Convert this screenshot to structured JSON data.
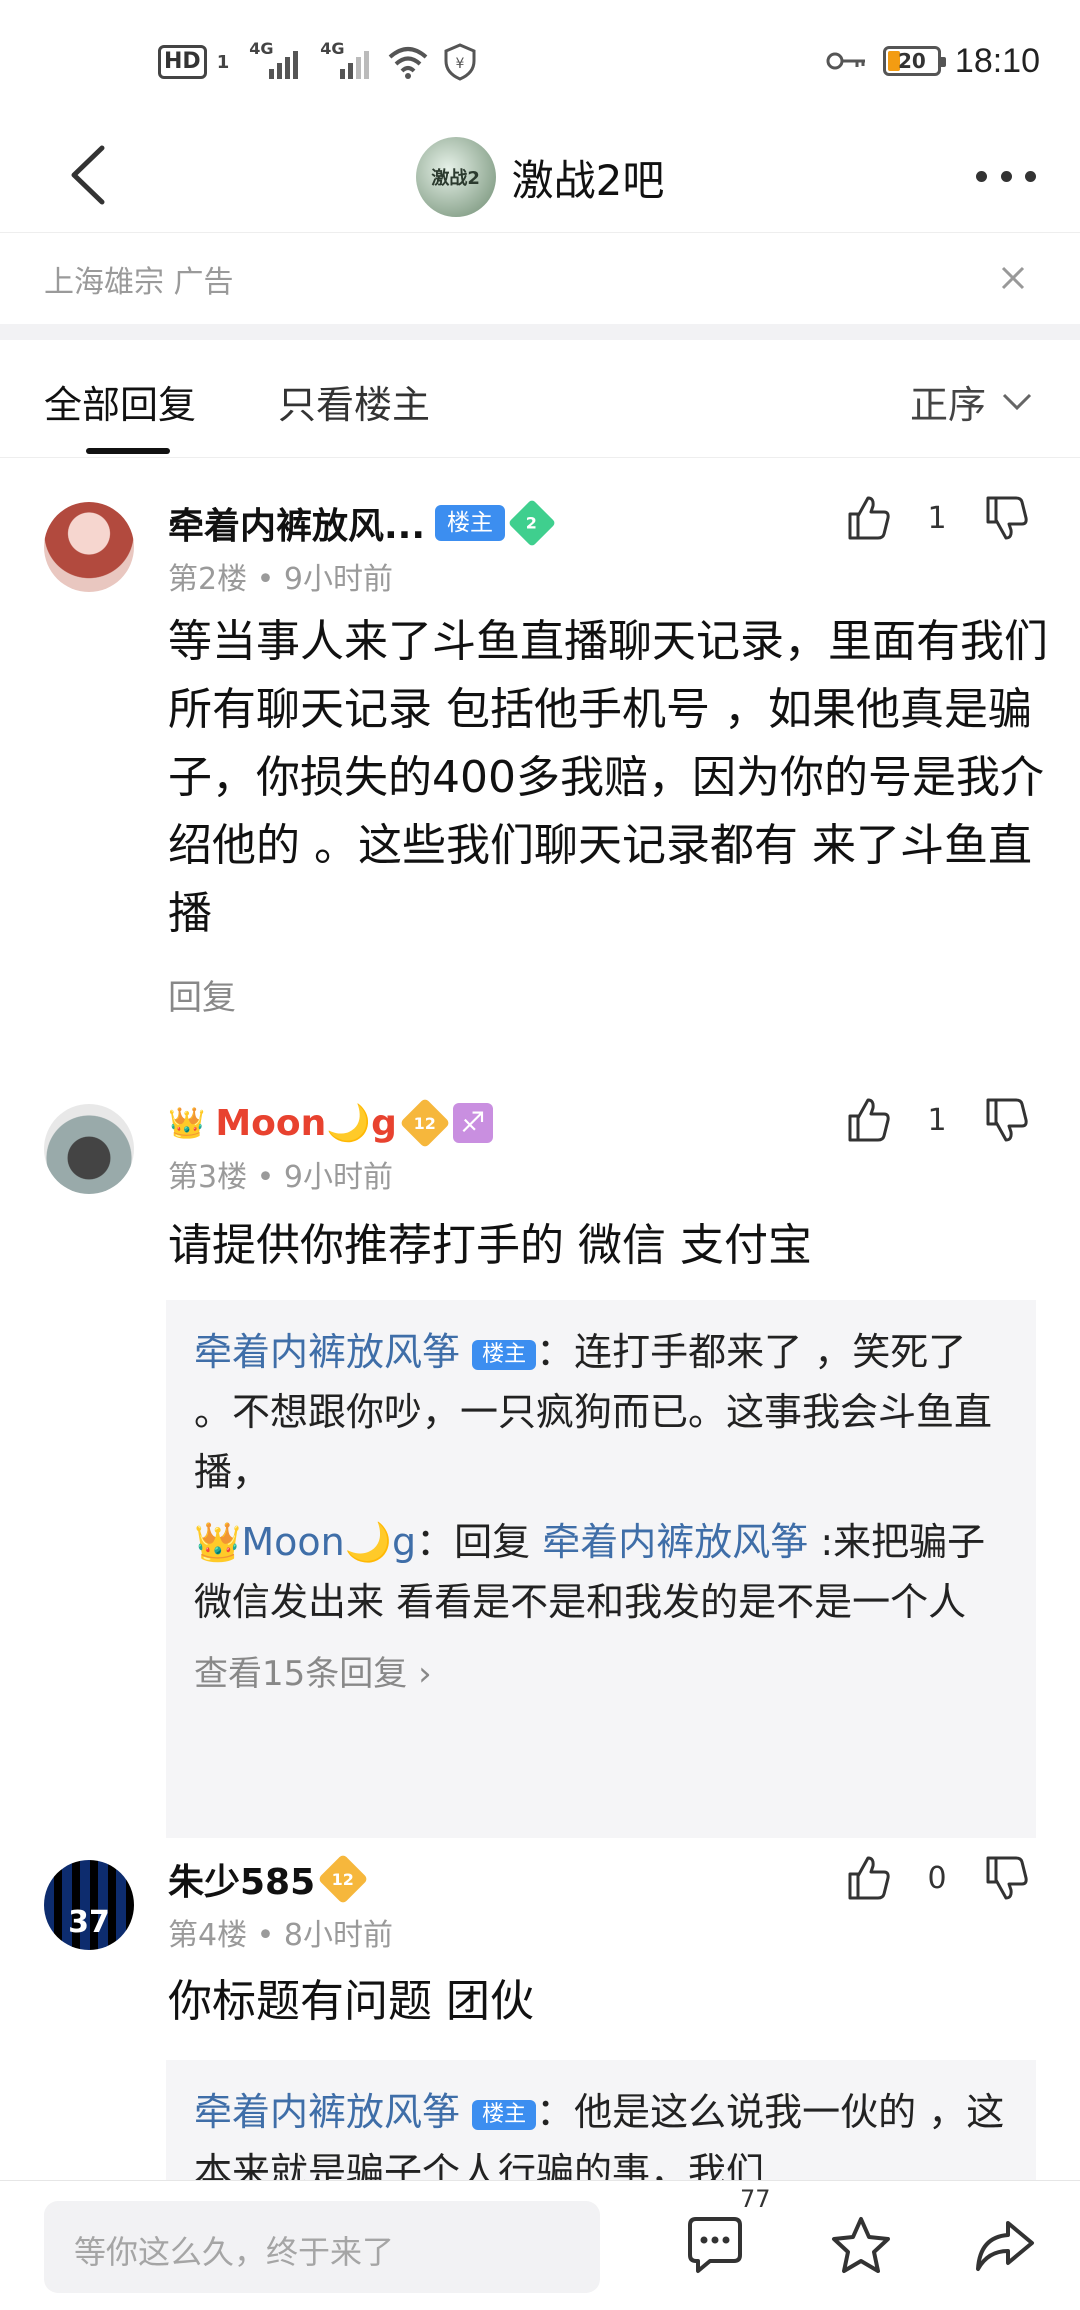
{
  "status_bar": {
    "hd": "HD",
    "hd_sub": "1",
    "net1": "4G",
    "net2": "4G",
    "battery": "20",
    "time": "18:10"
  },
  "nav": {
    "logo_text": "激战2",
    "title": "激战2吧"
  },
  "ad": {
    "text": "上海雄宗  广告"
  },
  "tabs": {
    "all": "全部回复",
    "host_only": "只看楼主",
    "order": "正序"
  },
  "posts": [
    {
      "name": "牵着内裤放风...",
      "host_badge": "楼主",
      "level": "2",
      "meta": "第2楼 • 9小时前",
      "likes": "1",
      "content": "等当事人来了斗鱼直播聊天记录，里面有我们所有聊天记录 包括他手机号 ，如果他真是骗子，你损失的400多我赔，因为你的号是我介绍他的 。这些我们聊天记录都有 来了斗鱼直播",
      "reply_label": "回复"
    },
    {
      "crown": "👑",
      "name": "Moon🌙g",
      "level": "12",
      "zodiac": "♐",
      "meta": "第3楼 • 9小时前",
      "likes": "1",
      "content": "请提供你推荐打手的 微信 支付宝",
      "subreplies": [
        {
          "user": "牵着内裤放风筝",
          "badge": "楼主",
          "text": "：连打手都来了 ，笑死了 。不想跟你吵，一只疯狗而已。这事我会斗鱼直播，"
        },
        {
          "user": "👑Moon🌙g",
          "reply_word": "：回复 ",
          "reply_to": "牵着内裤放风筝",
          "text": " :来把骗子微信发出来 看看是不是和我发的是不是一个人"
        }
      ],
      "more": "查看15条回复 ›"
    },
    {
      "name": "朱少585",
      "level": "12",
      "avatar_text": "37",
      "meta": "第4楼 • 8小时前",
      "likes": "0",
      "content": "你标题有问题 团伙",
      "subreplies": [
        {
          "user": "牵着内裤放风筝",
          "badge": "楼主",
          "text": "：他是这么说我一伙的 ，这本来就是骗子个人行骗的事，我们"
        }
      ]
    }
  ],
  "bottom": {
    "placeholder": "等你这么久，终于来了",
    "comment_count": "77"
  }
}
